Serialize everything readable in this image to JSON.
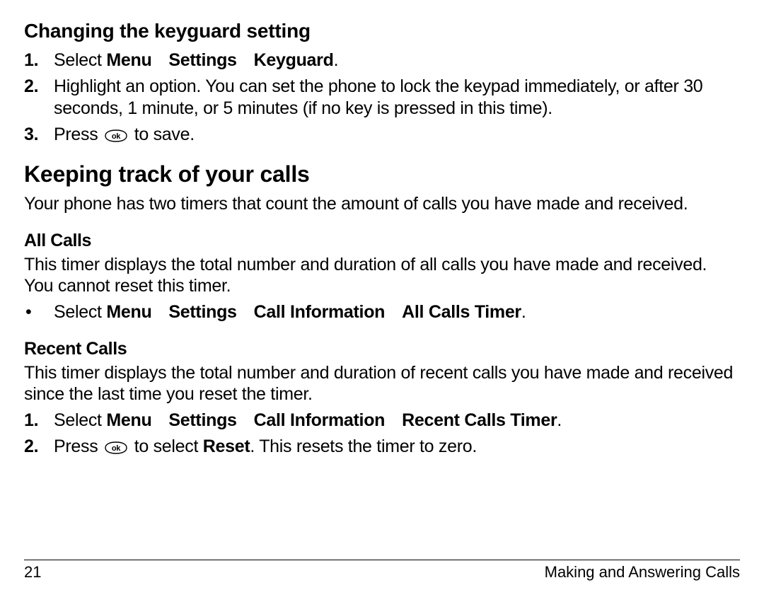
{
  "section1": {
    "title": "Changing the keyguard setting",
    "steps": [
      {
        "n": "1.",
        "pre": "Select ",
        "path": [
          "Menu",
          "Settings",
          "Keyguard"
        ],
        "tail": "."
      },
      {
        "n": "2.",
        "text": "Highlight an option. You can set the phone to lock the keypad immediately, or after 30 seconds, 1 minute, or 5 minutes (if no key is pressed in this time)."
      },
      {
        "n": "3.",
        "pre": "Press ",
        "ok": true,
        "post": " to save."
      }
    ]
  },
  "section2": {
    "title": "Keeping track of your calls",
    "intro": "Your phone has two timers that count the amount of calls you have made and received."
  },
  "allcalls": {
    "title": "All Calls",
    "body": "This timer displays the total number and duration of all calls you have made and received. You cannot reset this timer.",
    "bullet": {
      "pre": "Select ",
      "path": [
        "Menu",
        "Settings",
        "Call Information",
        "All Calls Timer"
      ],
      "tail": "."
    }
  },
  "recent": {
    "title": "Recent Calls",
    "body": "This timer displays the total number and duration of recent calls you have made and received since the last time you reset the timer.",
    "steps": [
      {
        "n": "1.",
        "pre": "Select ",
        "path": [
          "Menu",
          "Settings",
          "Call Information",
          "Recent Calls Timer"
        ],
        "tail": "."
      },
      {
        "n": "2.",
        "pre": "Press ",
        "ok": true,
        "mid": " to select ",
        "bold": "Reset",
        "post": ". This resets the timer to zero."
      }
    ]
  },
  "footer": {
    "page": "21",
    "label": "Making and Answering Calls"
  }
}
